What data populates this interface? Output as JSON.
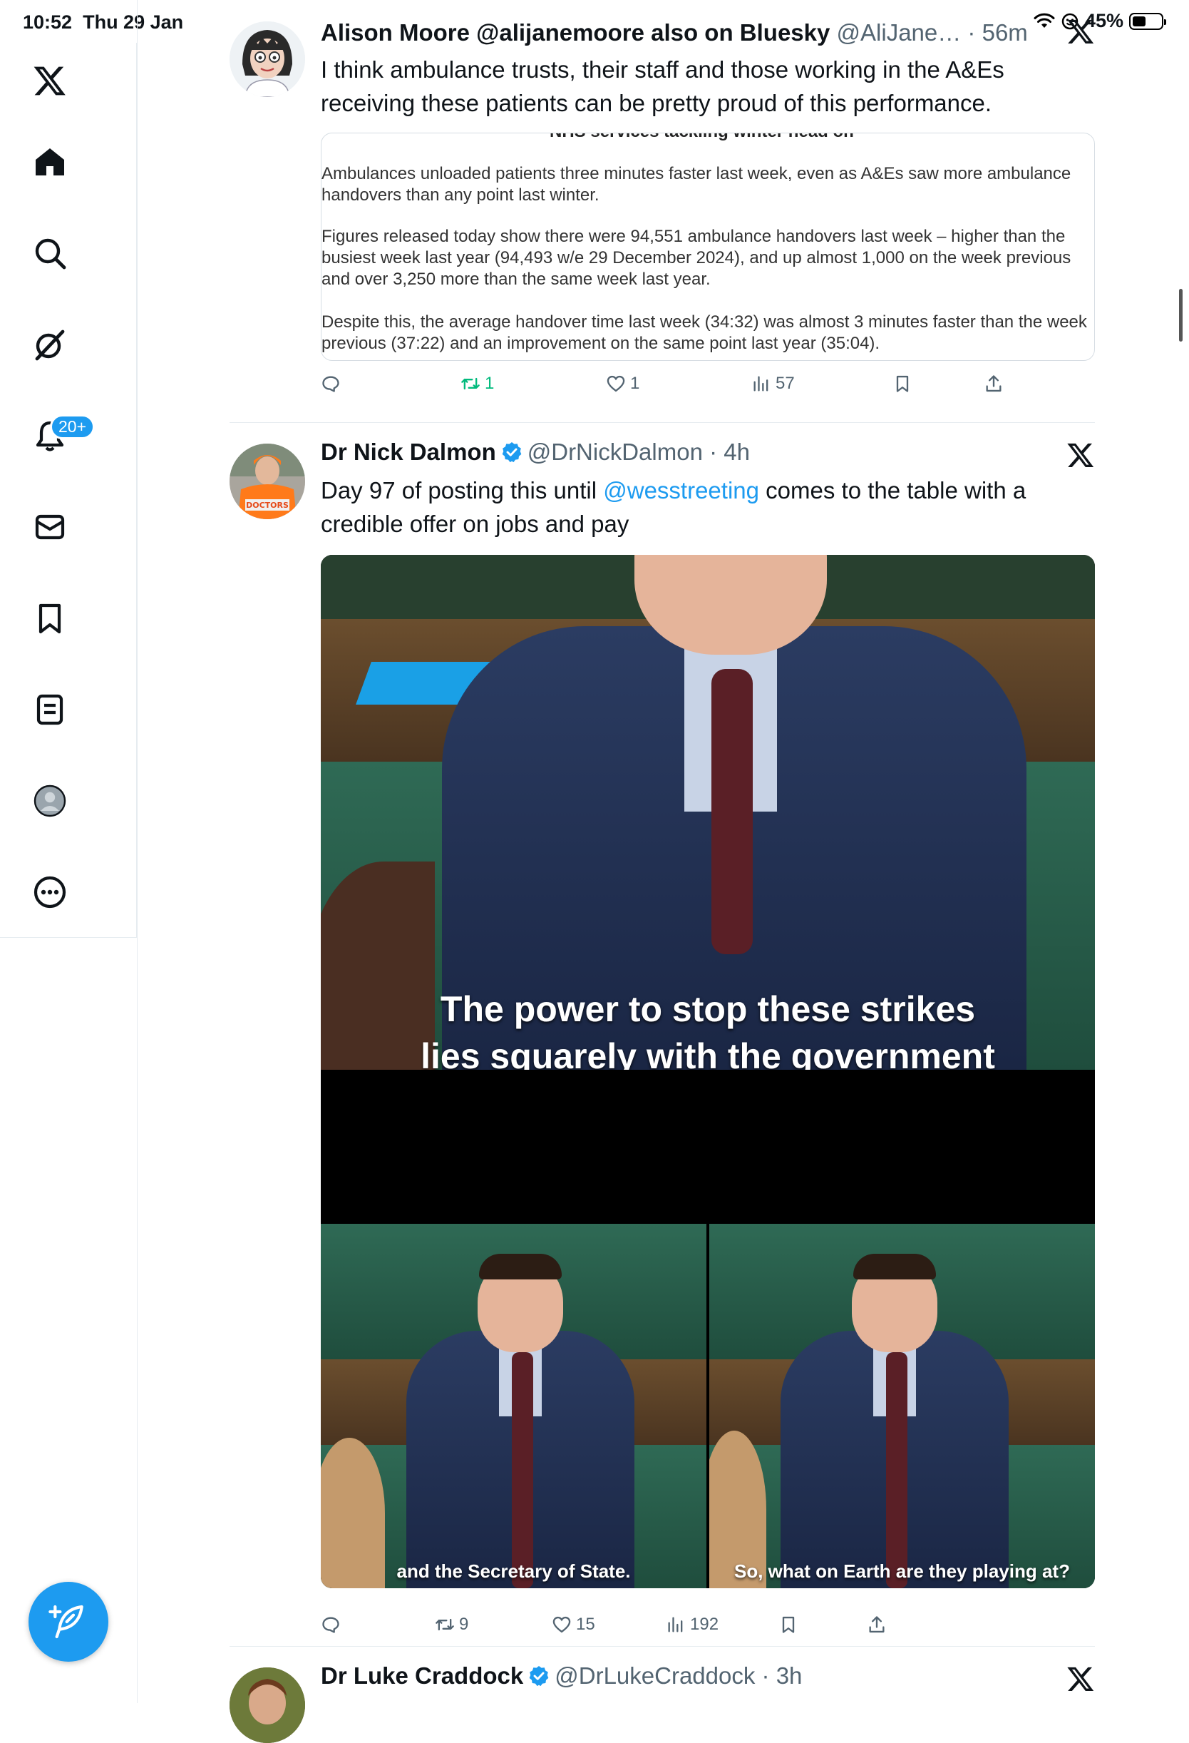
{
  "status_bar": {
    "time": "10:52",
    "date": "Thu 29 Jan",
    "battery": "45%",
    "battery_level": 0.45
  },
  "sidebar": {
    "items": [
      "x-logo",
      "home",
      "search",
      "grok",
      "notifications",
      "messages",
      "bookmarks",
      "lists",
      "profile",
      "more"
    ],
    "notifications_badge": "20+",
    "compose": "compose-post"
  },
  "tweets": [
    {
      "name": "Alison Moore @alijanemoore also on Bluesky",
      "handle": "@AliJane…",
      "time": "56m",
      "text": "I think ambulance trusts, their staff and those working in the A&Es receiving these patients can be pretty proud of this performance.",
      "card": {
        "cut_heading": "NHS services tackling winter head on",
        "p1": "Ambulances unloaded patients three minutes faster last week, even as A&Es saw more ambulance handovers than any point last winter.",
        "p2": "Figures released today show there were 94,551 ambulance handovers last week – higher than the busiest week last year (94,493 w/e 29 December 2024), and up almost 1,000 on the week previous and over 3,250 more than the same week last year.",
        "p3": "Despite this, the average handover time last week (34:32) was almost 3 minutes faster than the week previous (37:22) and an improvement on the same point last year (35:04)."
      },
      "retweets": "1",
      "likes": "1",
      "views": "57"
    },
    {
      "name": "Dr Nick Dalmon",
      "handle": "@DrNickDalmon",
      "time": "4h",
      "text_before": "Day 97 of posting this until ",
      "mention": "@wesstreeting",
      "text_after": " comes to the table with a credible offer on jobs and pay",
      "avatar_sign": "DOCTORS",
      "video": {
        "caption_1": "The power to stop these strikes",
        "caption_2": "lies squarely with the government",
        "caption_left": "and the Secretary of State.",
        "caption_right": "So, what on Earth are they playing at?"
      },
      "retweets": "9",
      "likes": "15",
      "views": "192"
    },
    {
      "name": "Dr Luke Craddock",
      "handle": "@DrLukeCraddock",
      "time": "3h"
    }
  ],
  "colors": {
    "accent": "#1d9bf0",
    "retweet_active": "#00ba7c",
    "text_secondary": "#536471"
  }
}
